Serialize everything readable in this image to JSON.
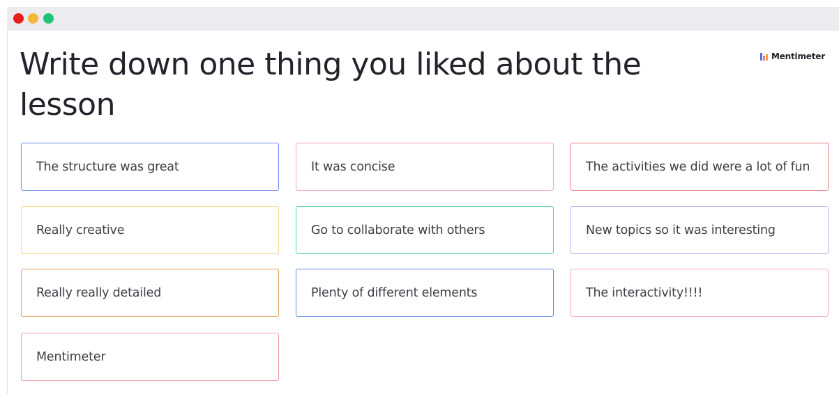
{
  "window": {
    "controls": [
      "close",
      "minimize",
      "maximize"
    ]
  },
  "slide": {
    "question": "Write down one thing you liked about the lesson",
    "brand": "Mentimeter",
    "brand_icon": "mentimeter-bar-logo-icon"
  },
  "responses": [
    {
      "text": "The structure was great",
      "color": "#6f8ff0"
    },
    {
      "text": "It was concise",
      "color": "#f2a6b3"
    },
    {
      "text": "The activities we did were a lot of fun",
      "color": "#ef7b85"
    },
    {
      "text": "Really creative",
      "color": "#f9d98c"
    },
    {
      "text": "Go to collaborate with others",
      "color": "#4fd39e"
    },
    {
      "text": "New topics so it was interesting",
      "color": "#b8b3ea"
    },
    {
      "text": "Really really detailed",
      "color": "#d9a55c"
    },
    {
      "text": "Plenty of different elements",
      "color": "#5f84e6"
    },
    {
      "text": "The interactivity!!!!",
      "color": "#f2a9b7"
    },
    {
      "text": "Mentimeter",
      "color": "#f0a0a8"
    }
  ],
  "colors": {
    "close": "#e5201d",
    "minimize": "#f4b73a",
    "maximize": "#1fc47a",
    "title_text": "#22232b",
    "card_text": "#3e3f47"
  }
}
